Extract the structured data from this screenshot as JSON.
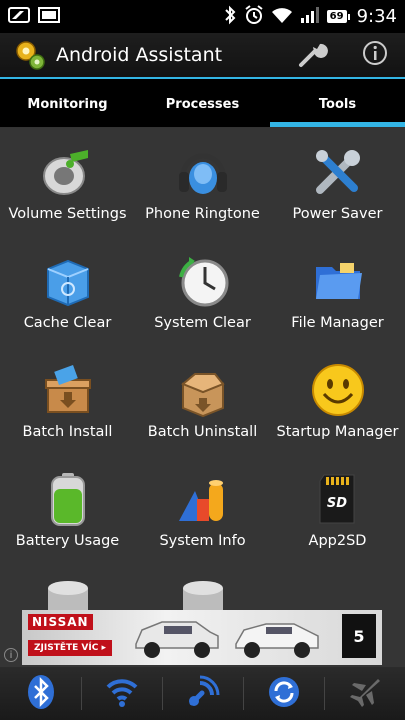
{
  "status_bar": {
    "time": "9:34",
    "battery": "69",
    "icons": [
      "notification-icon",
      "image-icon",
      "bluetooth-icon",
      "alarm-icon",
      "wifi-icon",
      "signal-icon",
      "battery-icon"
    ]
  },
  "app": {
    "title": "Android Assistant",
    "actions": [
      "wrench-icon",
      "info-icon"
    ]
  },
  "tabs": [
    {
      "label": "Monitoring",
      "active": false
    },
    {
      "label": "Processes",
      "active": false
    },
    {
      "label": "Tools",
      "active": true
    }
  ],
  "tools": [
    {
      "label": "Volume Settings",
      "icon": "volume-icon"
    },
    {
      "label": "Phone Ringtone",
      "icon": "headphones-icon"
    },
    {
      "label": "Power Saver",
      "icon": "tools-icon"
    },
    {
      "label": "Cache Clear",
      "icon": "recycle-box-icon"
    },
    {
      "label": "System Clear",
      "icon": "clock-icon"
    },
    {
      "label": "File Manager",
      "icon": "folder-icon"
    },
    {
      "label": "Batch Install",
      "icon": "box-install-icon"
    },
    {
      "label": "Batch Uninstall",
      "icon": "box-open-icon"
    },
    {
      "label": "Startup Manager",
      "icon": "smiley-icon"
    },
    {
      "label": "Battery Usage",
      "icon": "battery-icon"
    },
    {
      "label": "System Info",
      "icon": "shapes-icon"
    },
    {
      "label": "App2SD",
      "icon": "sd-card-icon"
    }
  ],
  "ad": {
    "brand": "NISSAN",
    "cta": "ZJISTĚTE VÍC ▸",
    "badge": "5"
  },
  "toggles": [
    "bluetooth-toggle-icon",
    "wifi-toggle-icon",
    "gps-toggle-icon",
    "sync-toggle-icon",
    "airplane-toggle-icon"
  ],
  "colors": {
    "accent": "#33b5e5",
    "background": "#353535"
  }
}
